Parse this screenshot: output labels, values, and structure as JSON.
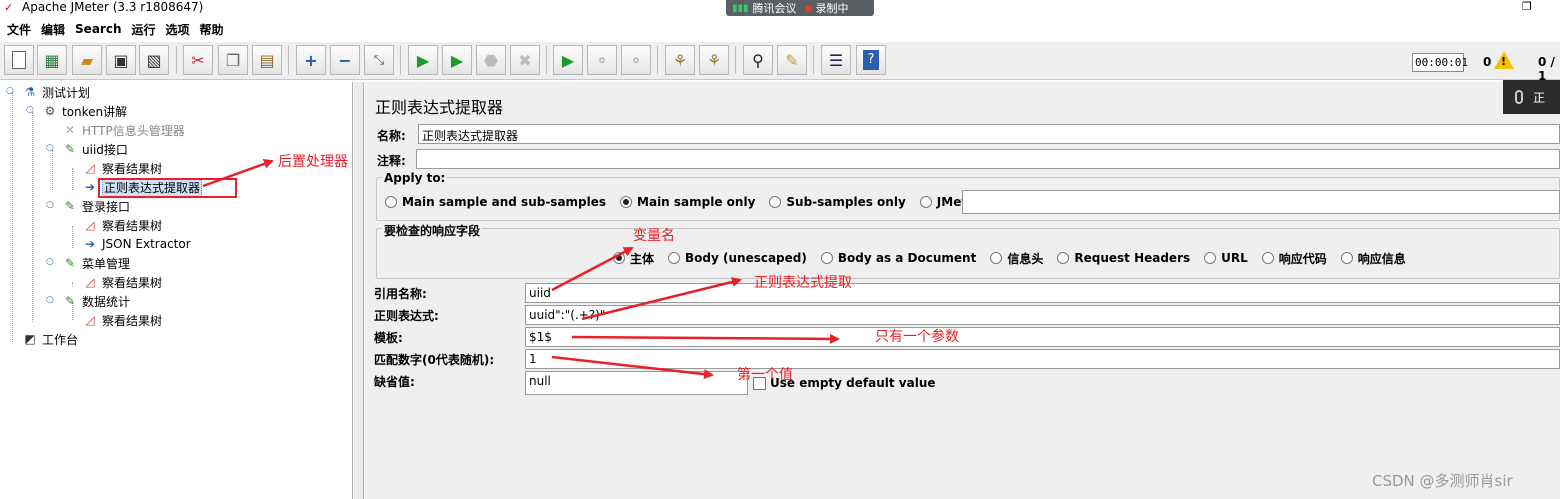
{
  "window": {
    "title": "Apache JMeter (3.3 r1808647)",
    "meeting_app": "腾讯会议",
    "recording": "录制中"
  },
  "menu": [
    "文件",
    "编辑",
    "Search",
    "运行",
    "选项",
    "帮助"
  ],
  "toolbar": {
    "buttons": [
      {
        "name": "new-icon",
        "glyph": "□"
      },
      {
        "name": "templates-icon",
        "glyph": "▦"
      },
      {
        "name": "open-icon",
        "glyph": "▰"
      },
      {
        "name": "save-icon",
        "glyph": "▣"
      },
      {
        "name": "save-as-icon",
        "glyph": "▧"
      },
      {
        "name": "cut-icon",
        "glyph": "✂"
      },
      {
        "name": "copy-icon",
        "glyph": "❐"
      },
      {
        "name": "paste-icon",
        "glyph": "📋"
      },
      {
        "name": "expand-icon",
        "glyph": "+"
      },
      {
        "name": "collapse-icon",
        "glyph": "−"
      },
      {
        "name": "toggle-icon",
        "glyph": "⤡"
      },
      {
        "name": "start-icon",
        "glyph": "▶"
      },
      {
        "name": "start-no-pause-icon",
        "glyph": "▶"
      },
      {
        "name": "stop-icon",
        "glyph": "■"
      },
      {
        "name": "shutdown-icon",
        "glyph": "✖"
      },
      {
        "name": "remote-start-icon",
        "glyph": "▶"
      },
      {
        "name": "remote-stop-icon",
        "glyph": "◦"
      },
      {
        "name": "remote-shutdown-icon",
        "glyph": "◦"
      },
      {
        "name": "clear-icon",
        "glyph": "🧹"
      },
      {
        "name": "clear-all-icon",
        "glyph": "🧹"
      },
      {
        "name": "search-icon",
        "glyph": "⚲"
      },
      {
        "name": "reset-search-icon",
        "glyph": "✎"
      },
      {
        "name": "function-helper-icon",
        "glyph": "☰"
      },
      {
        "name": "help-icon",
        "glyph": "?"
      }
    ],
    "timer": "00:00:01",
    "warnings": "0",
    "threads": "0 / 1"
  },
  "tree": [
    {
      "label": "测试计划",
      "icon": "test-plan-icon",
      "level": 0
    },
    {
      "label": "tonken讲解",
      "icon": "thread-group-icon",
      "level": 1
    },
    {
      "label": "HTTP信息头管理器",
      "icon": "header-manager-icon",
      "level": 2,
      "disabled": true
    },
    {
      "label": "uiid接口",
      "icon": "sampler-icon",
      "level": 2
    },
    {
      "label": "察看结果树",
      "icon": "listener-icon",
      "level": 3
    },
    {
      "label": "正则表达式提取器",
      "icon": "extractor-icon",
      "level": 3,
      "selected": true
    },
    {
      "label": "登录接口",
      "icon": "sampler-icon",
      "level": 2
    },
    {
      "label": "察看结果树",
      "icon": "listener-icon",
      "level": 3
    },
    {
      "label": "JSON Extractor",
      "icon": "extractor-icon",
      "level": 3
    },
    {
      "label": "菜单管理",
      "icon": "sampler-icon",
      "level": 2
    },
    {
      "label": "察看结果树",
      "icon": "listener-icon",
      "level": 3
    },
    {
      "label": "数据统计",
      "icon": "sampler-icon",
      "level": 2
    },
    {
      "label": "察看结果树",
      "icon": "listener-icon",
      "level": 3
    },
    {
      "label": "工作台",
      "icon": "workbench-icon",
      "level": 0
    }
  ],
  "panel": {
    "title": "正则表达式提取器",
    "name_label": "名称:",
    "name_value": "正则表达式提取器",
    "comment_label": "注释:",
    "comment_value": "",
    "apply_to": {
      "legend": "Apply to:",
      "options": [
        "Main sample and sub-samples",
        "Main sample only",
        "Sub-samples only",
        "JMeter Variable"
      ],
      "selected": 1,
      "variable_value": ""
    },
    "field_to_check": {
      "legend": "要检查的响应字段",
      "options": [
        "主体",
        "Body (unescaped)",
        "Body as a Document",
        "信息头",
        "Request Headers",
        "URL",
        "响应代码",
        "响应信息"
      ],
      "selected": 0
    },
    "ref_name_label": "引用名称:",
    "ref_name_value": "uiid",
    "regex_label": "正则表达式:",
    "regex_value": "uuid\":\"(.+?)\"",
    "template_label": "模板:",
    "template_value": "$1$",
    "match_no_label": "匹配数字(0代表随机):",
    "match_no_value": "1",
    "default_label": "缺省值:",
    "default_value": "null",
    "use_empty_label": "Use empty default value"
  },
  "annotations": {
    "post_processor": "后置处理器",
    "variable_name": "变量名",
    "regex_extract": "正则表达式提取",
    "only_one_param": "只有一个参数",
    "first_value": "第一个值"
  },
  "voice_chip": "正",
  "watermark": "CSDN @多测师肖sir",
  "colors": {
    "annotation_red": "#e8202a",
    "selection_blue": "#cfe0f5"
  }
}
